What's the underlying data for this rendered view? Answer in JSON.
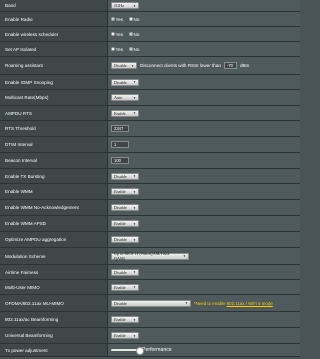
{
  "rows": [
    {
      "label": "Band",
      "type": "select",
      "value": "5GHz"
    },
    {
      "label": "Enable Radio",
      "type": "radio",
      "options": [
        "Yes",
        "No"
      ],
      "selected": 0
    },
    {
      "label": "Enable wireless scheduler",
      "type": "radio",
      "options": [
        "Yes",
        "No"
      ],
      "selected": 1
    },
    {
      "label": "Set AP Isolated",
      "type": "radio",
      "options": [
        "Yes",
        "No"
      ],
      "selected": 1
    },
    {
      "label": "Roaming assistant",
      "type": "roaming",
      "value": "Disable",
      "text": "Disconnect clients with RSSI lower than",
      "input": "-70",
      "unit": "dBm"
    },
    {
      "label": "Enable IGMP Snooping",
      "type": "select",
      "value": "Disable"
    },
    {
      "label": "Multicast Rate(Mbps)",
      "type": "select",
      "value": "Auto"
    },
    {
      "label": "AMPDU RTS",
      "type": "select",
      "value": "Enable"
    },
    {
      "label": "RTS Threshold",
      "type": "input",
      "value": "2347"
    },
    {
      "label": "DTIM Interval",
      "type": "input",
      "value": "1"
    },
    {
      "label": "Beacon Interval",
      "type": "input",
      "value": "100"
    },
    {
      "label": "Enable TX Bursting",
      "type": "select",
      "value": "Disable"
    },
    {
      "label": "Enable WMM",
      "type": "select",
      "value": "Enable"
    },
    {
      "label": "Enable WMM No-Acknowledgement",
      "type": "select",
      "value": "Disable"
    },
    {
      "label": "Enable WMM APSD",
      "type": "select",
      "value": "Enable"
    },
    {
      "label": "Optimize AMPDU aggregation",
      "type": "select",
      "value": "Disable"
    },
    {
      "label": "Modulation Scheme",
      "type": "select",
      "value": "Up to MCS 11 (NitroQAM/1024-QAM)",
      "wide": true
    },
    {
      "label": "Airtime Fairness",
      "type": "select",
      "value": "Disable"
    },
    {
      "label": "Multi-User MIMO",
      "type": "select",
      "value": "Enable"
    },
    {
      "label": "OFDMA/802.11ax MU-MIMO",
      "type": "ofdma",
      "value": "Disable",
      "hint_prefix": "*Need to enable",
      "hint_link": "802.11ax / WiFi 6 mode"
    },
    {
      "label": "802.11ax/ac Beamforming",
      "type": "select",
      "value": "Enable"
    },
    {
      "label": "Universal Beamforming",
      "type": "select",
      "value": "Enable"
    },
    {
      "label": "Tx power adjustment",
      "type": "slider",
      "value_text": "Performance",
      "level": 1.0
    }
  ]
}
